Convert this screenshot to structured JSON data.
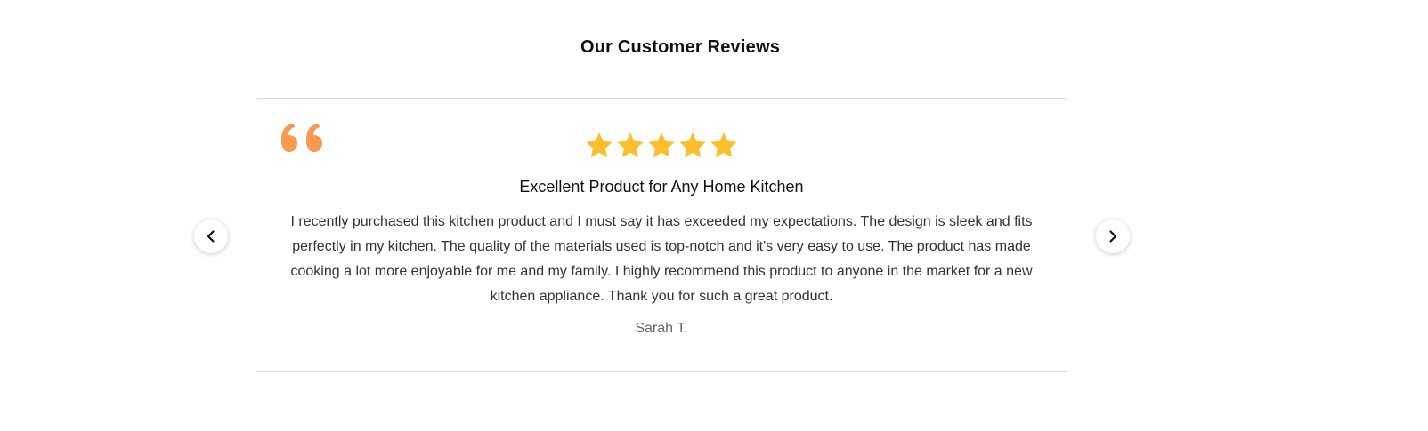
{
  "section": {
    "title": "Our Customer Reviews"
  },
  "review": {
    "rating": 5,
    "rating_max": 5,
    "title": "Excellent Product for Any Home Kitchen",
    "body": "I recently purchased this kitchen product and I must say it has exceeded my expectations. The design is sleek and fits perfectly in my kitchen. The quality of the materials used is top-notch and it's very easy to use. The product has made cooking a lot more enjoyable for me and my family. I highly recommend this product to anyone in the market for a new kitchen appliance. Thank you for such a great product.",
    "author": "Sarah T."
  },
  "icons": {
    "quote": "quote-icon",
    "star": "star-icon",
    "prev": "chevron-left-icon",
    "next": "chevron-right-icon"
  },
  "colors": {
    "quote": "#f79a4f",
    "star": "#fbbf2e",
    "border": "#dcdcdc"
  }
}
